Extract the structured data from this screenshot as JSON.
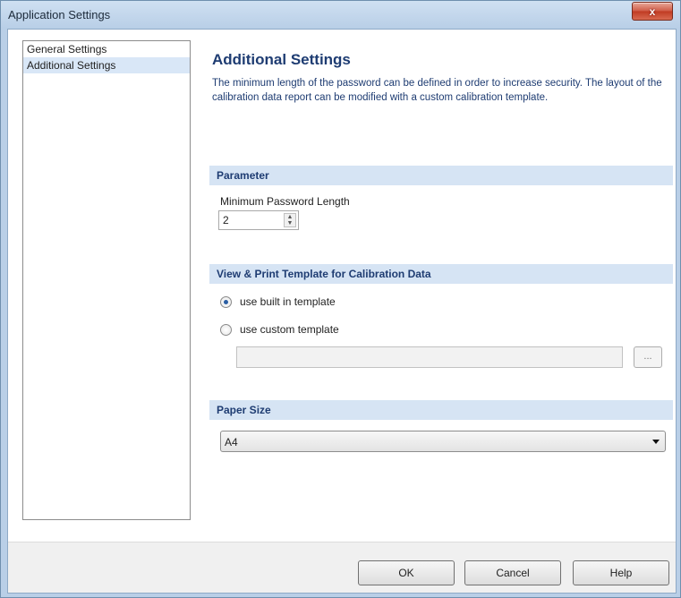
{
  "window": {
    "title": "Application Settings",
    "close_label": "x"
  },
  "nav": {
    "items": [
      {
        "label": "General Settings",
        "selected": false
      },
      {
        "label": "Additional Settings",
        "selected": true
      }
    ]
  },
  "main": {
    "heading": "Additional Settings",
    "description": "The minimum length of the password can be defined in order to increase security. The layout of the calibration data report can be modified with a custom calibration template.",
    "parameter": {
      "header": "Parameter",
      "min_password_label": "Minimum Password Length",
      "min_password_value": "2"
    },
    "template": {
      "header": "View & Print Template for Calibration Data",
      "option_builtin": "use built in template",
      "option_custom": "use custom template",
      "selected": "builtin",
      "path_value": "",
      "browse_label": "..."
    },
    "paper": {
      "header": "Paper Size",
      "selected": "A4"
    }
  },
  "footer": {
    "ok_label": "OK",
    "cancel_label": "Cancel",
    "help_label": "Help"
  },
  "colors": {
    "title_bar": "#b9cfe7",
    "group_header_bg": "#d6e4f4",
    "heading_text": "#1e3c72",
    "selected_item_bg": "#d9e7f7",
    "close_button": "#c03a22"
  }
}
